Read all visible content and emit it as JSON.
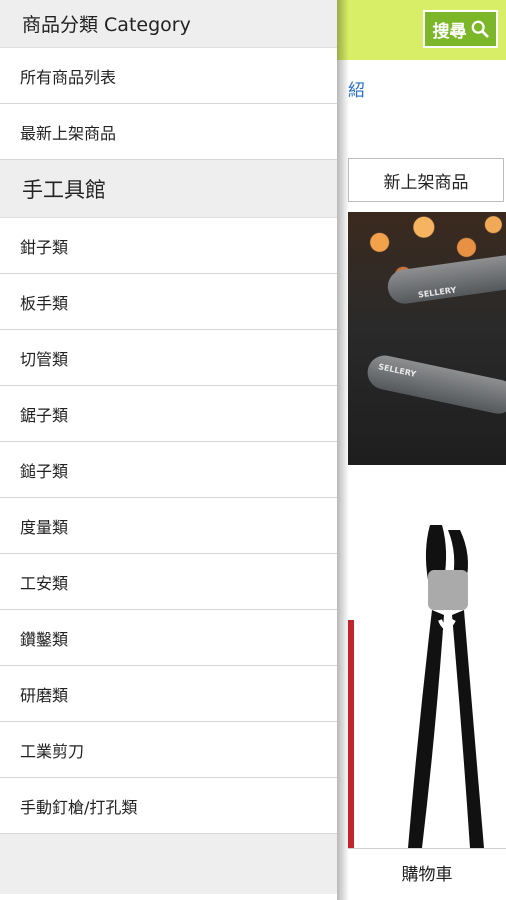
{
  "header": {
    "search_label": "搜尋"
  },
  "background": {
    "partial_link": "紹",
    "new_products_tab": "新上架商品",
    "cart_label": "購物車",
    "banner_brand": "SELLERY"
  },
  "drawer": {
    "category_header": "商品分類 Category",
    "top_items": [
      {
        "label": "所有商品列表"
      },
      {
        "label": "最新上架商品"
      }
    ],
    "section_header": "手工具館",
    "section_items": [
      {
        "label": "鉗子類"
      },
      {
        "label": "板手類"
      },
      {
        "label": "切管類"
      },
      {
        "label": "鋸子類"
      },
      {
        "label": "鎚子類"
      },
      {
        "label": "度量類"
      },
      {
        "label": "工安類"
      },
      {
        "label": "鑽鑿類"
      },
      {
        "label": "研磨類"
      },
      {
        "label": "工業剪刀"
      },
      {
        "label": "手動釘槍/打孔類"
      }
    ]
  },
  "colors": {
    "topbar": "#d8ee66",
    "search_button": "#7cb72a",
    "link": "#2a6fc9",
    "header_bg": "#eeeeee"
  }
}
